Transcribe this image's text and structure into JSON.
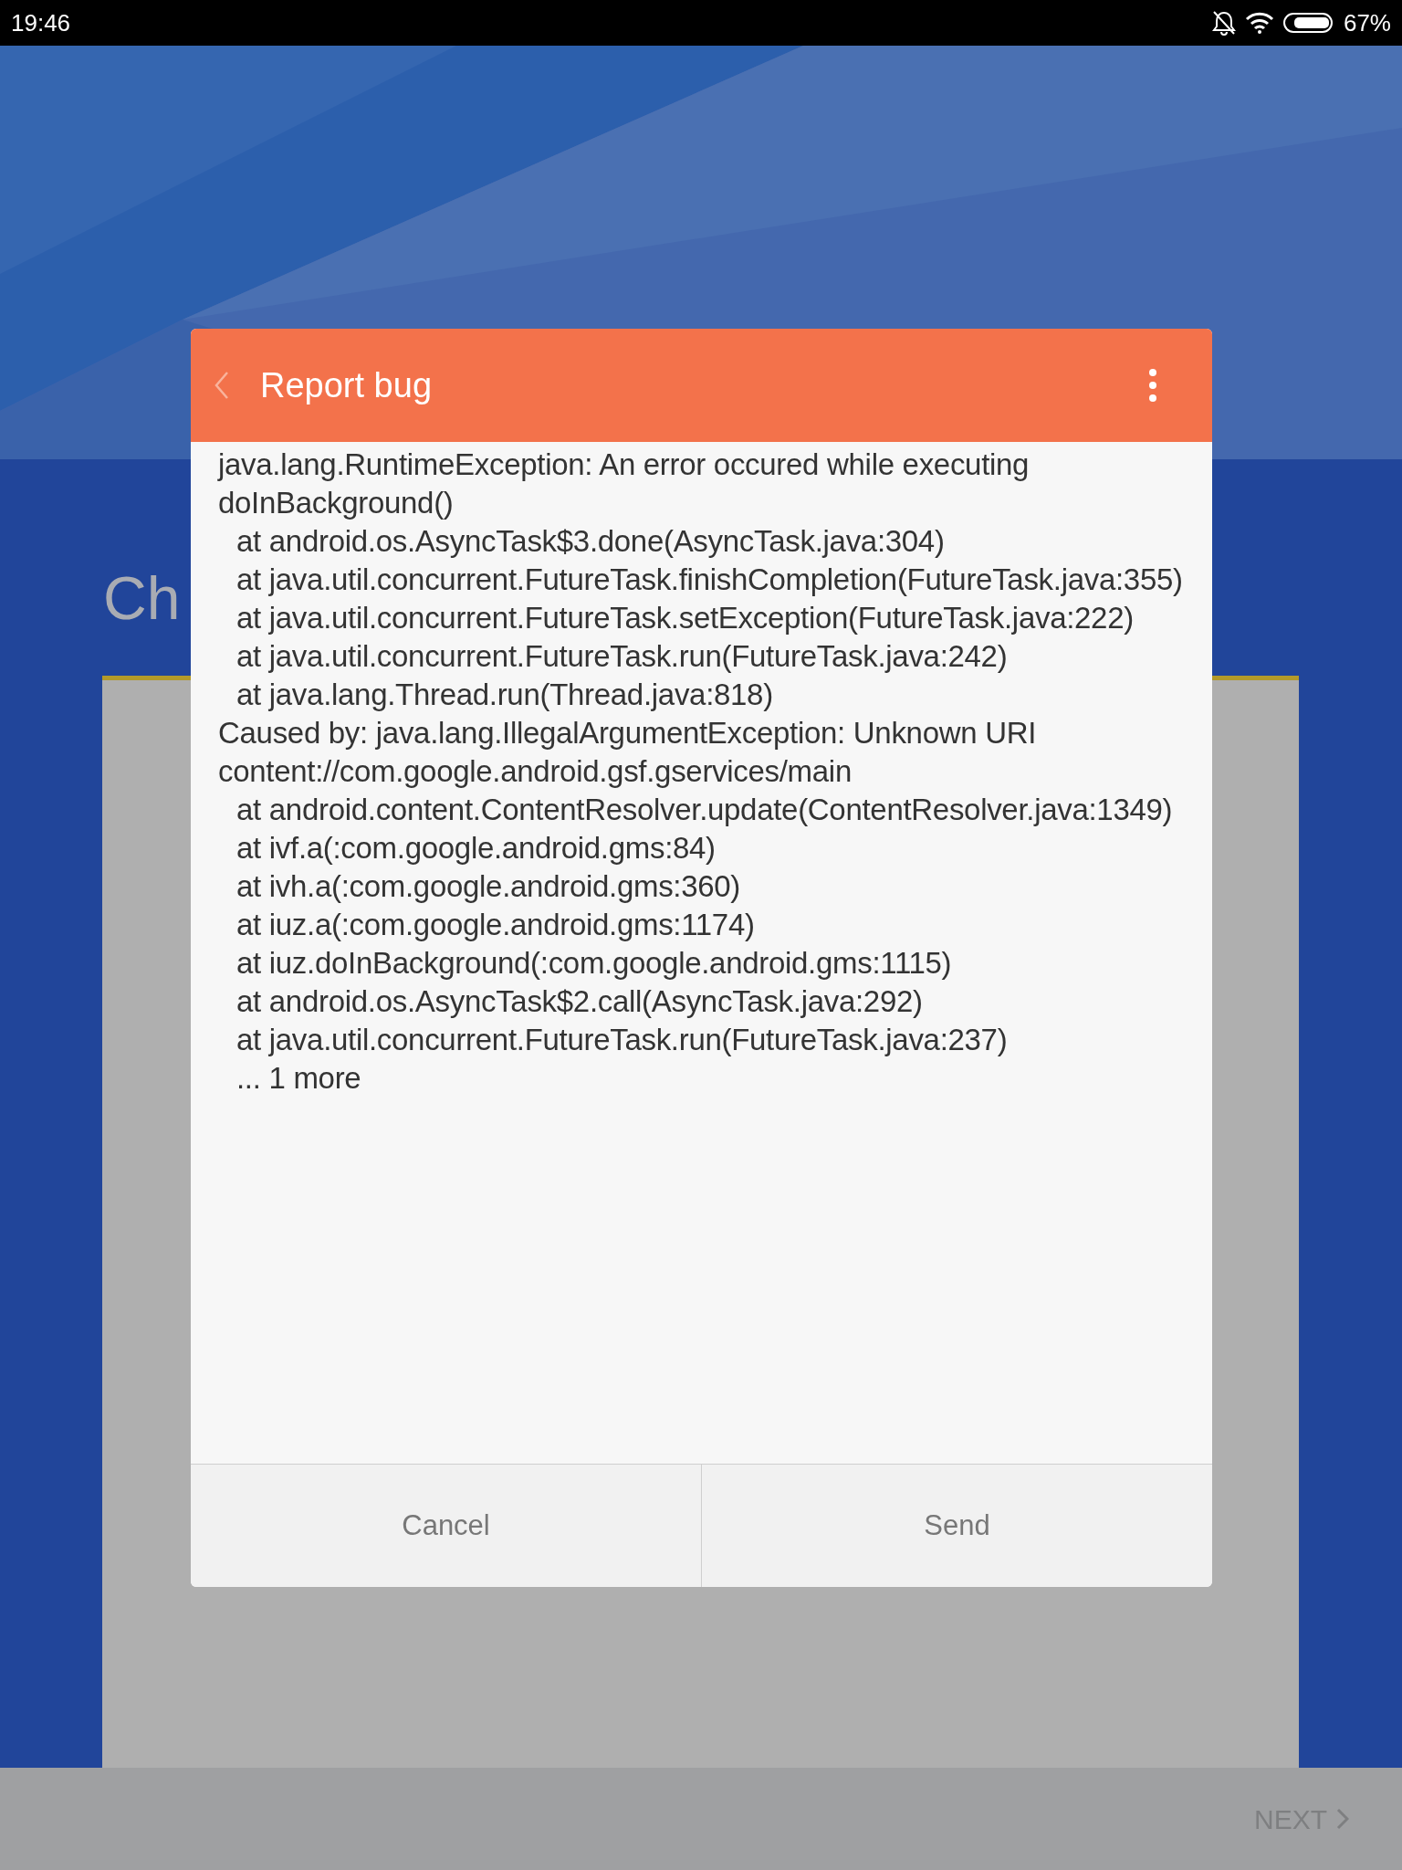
{
  "status_bar": {
    "time": "19:46",
    "battery": "67%"
  },
  "page": {
    "kind": "picture",
    "title": "Ch",
    "next": "NEXT"
  },
  "dialog": {
    "title": "Report bug",
    "lines": [
      {
        "kind": "message",
        "text": "java.lang.RuntimeException: An error occured while executing doInBackground()"
      },
      {
        "kind": "frame",
        "text": "at android.os.AsyncTask$3.done(AsyncTask.java:304)"
      },
      {
        "kind": "frame",
        "text": "at java.util.concurrent.FutureTask.finishCompletion(FutureTask.java:355)"
      },
      {
        "kind": "frame",
        "text": "at java.util.concurrent.FutureTask.setException(FutureTask.java:222)"
      },
      {
        "kind": "frame",
        "text": "at java.util.concurrent.FutureTask.run(FutureTask.java:242)"
      },
      {
        "kind": "frame",
        "text": "at java.lang.Thread.run(Thread.java:818)"
      },
      {
        "kind": "message",
        "text": "Caused by: java.lang.IllegalArgumentException: Unknown URI content://com.google.android.gsf.gservices/main"
      },
      {
        "kind": "frame",
        "text": "at android.content.ContentResolver.update(ContentResolver.java:1349)"
      },
      {
        "kind": "frame",
        "text": "at ivf.a(:com.google.android.gms:84)"
      },
      {
        "kind": "frame",
        "text": "at ivh.a(:com.google.android.gms:360)"
      },
      {
        "kind": "frame",
        "text": "at iuz.a(:com.google.android.gms:1174)"
      },
      {
        "kind": "frame",
        "text": "at iuz.doInBackground(:com.google.android.gms:1115)"
      },
      {
        "kind": "frame",
        "text": "at android.os.AsyncTask$2.call(AsyncTask.java:292)"
      },
      {
        "kind": "frame",
        "text": "at java.util.concurrent.FutureTask.run(FutureTask.java:237)"
      },
      {
        "kind": "frame",
        "text": "... 1 more"
      }
    ],
    "buttons": [
      "Cancel",
      "Send"
    ]
  }
}
